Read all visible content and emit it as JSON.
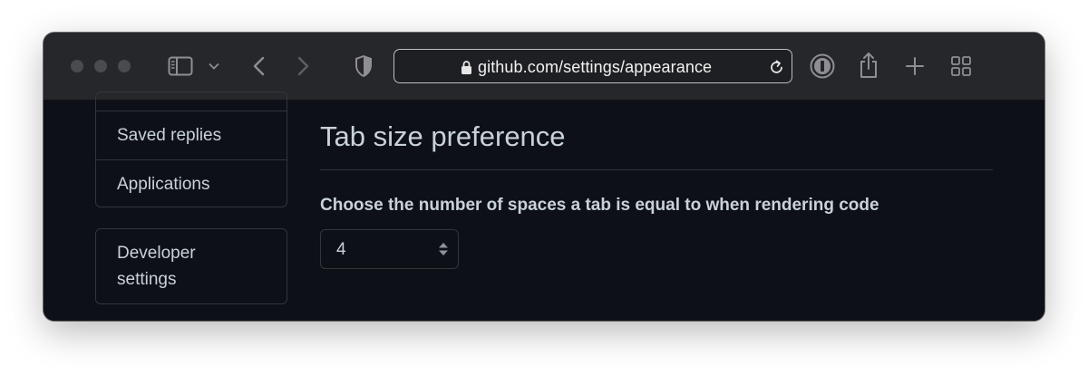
{
  "browser": {
    "url": "github.com/settings/appearance",
    "icons": {
      "sidebar": "sidebar-icon",
      "chevron": "chevron-down-icon",
      "back": "back-icon",
      "forward": "forward-icon",
      "privacy": "shield-icon",
      "lock": "lock-icon",
      "reload": "reload-icon",
      "password_manager": "onepassword-icon",
      "share": "share-icon",
      "new_tab": "plus-icon",
      "tab_overview": "grid-icon"
    }
  },
  "sidebar": {
    "items": [
      {
        "label": "Saved replies"
      },
      {
        "label": "Applications"
      }
    ],
    "developer": {
      "label_line1": "Developer",
      "label_line2": "settings"
    }
  },
  "main": {
    "title": "Tab size preference",
    "description": "Choose the number of spaces a tab is equal to when rendering code",
    "tab_size_select": {
      "value": "4"
    }
  },
  "colors": {
    "page_bg": "#0d1117",
    "border": "#30363d",
    "text": "#c9d1d9",
    "toolbar_bg": "#26272b"
  }
}
